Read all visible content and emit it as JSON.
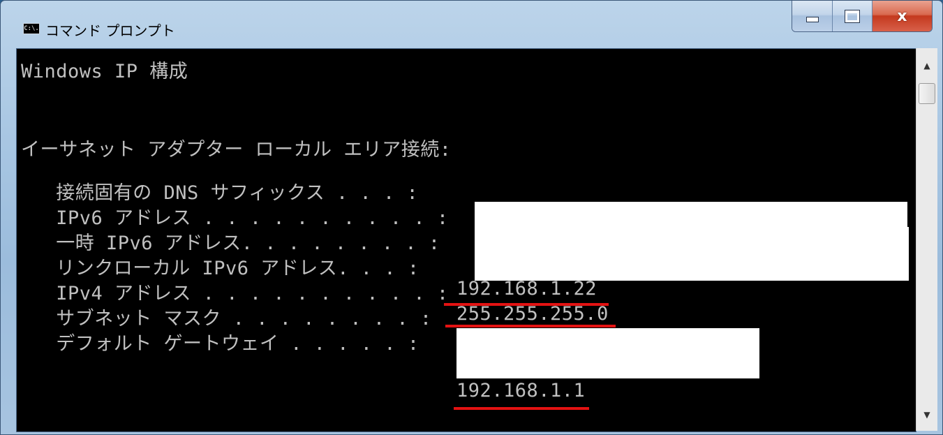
{
  "window": {
    "title": "コマンド プロンプト",
    "icon_label": "C:\\.",
    "controls": {
      "minimize": "minimize-icon",
      "maximize": "maximize-icon",
      "close": "x"
    }
  },
  "console": {
    "lines": [
      "Windows IP 構成",
      "イーサネット アダプター ローカル エリア接続:",
      "   接続固有の DNS サフィックス . . . :",
      "   IPv6 アドレス . . . . . . . . . . :",
      "   一時 IPv6 アドレス. . . . . . . . :",
      "   リンクローカル IPv6 アドレス. . . :",
      "   IPv4 アドレス . . . . . . . . . . :",
      "   サブネット マスク . . . . . . . . :",
      "   デフォルト ゲートウェイ . . . . . :"
    ],
    "ipv4": "192.168.1.22",
    "subnet_mask": "255.255.255.0",
    "gateway": "192.168.1.1"
  },
  "colors": {
    "console_bg": "#000000",
    "console_text": "#c0c0c0",
    "highlight_underline": "#e31212",
    "redaction": "#ffffff"
  },
  "scrollbar": {
    "up": "▲",
    "down": "▼"
  }
}
